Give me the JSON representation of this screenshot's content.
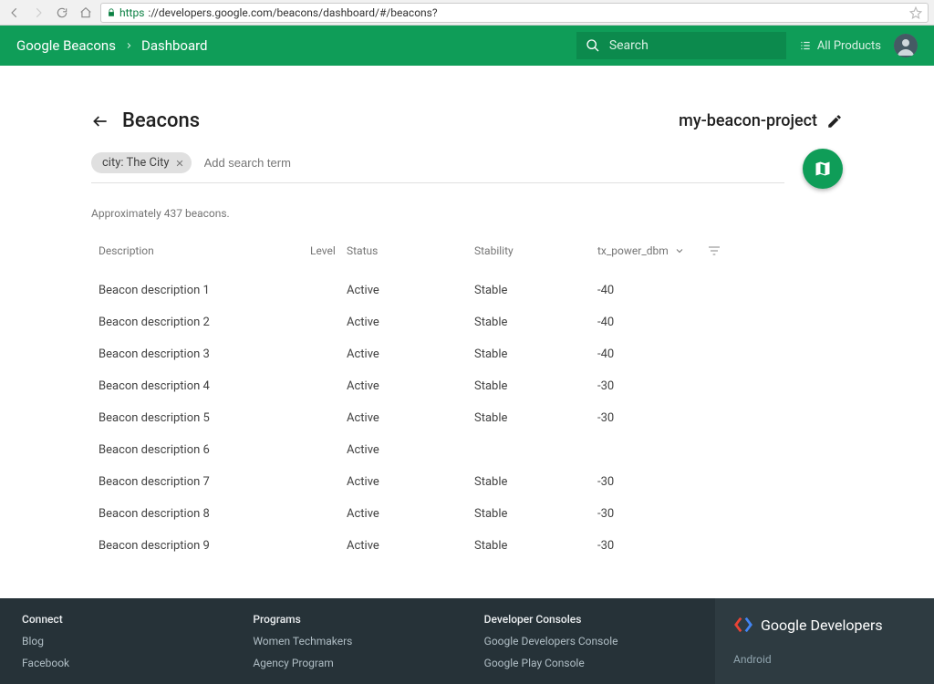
{
  "browser": {
    "url_prefix": "https",
    "url_rest": "://developers.google.com/beacons/dashboard/#/beacons?"
  },
  "header": {
    "app": "Google Beacons",
    "section": "Dashboard",
    "search_placeholder": "Search",
    "all_products": "All Products"
  },
  "page": {
    "back_title": "Beacons",
    "project": "my-beacon-project",
    "chip": "city: The City",
    "search_placeholder": "Add search term",
    "approx": "Approximately 437 beacons."
  },
  "columns": {
    "description": "Description",
    "level": "Level",
    "status": "Status",
    "stability": "Stability",
    "tx": "tx_power_dbm"
  },
  "rows": [
    {
      "description": "Beacon description 1",
      "level": "",
      "status": "Active",
      "stability": "Stable",
      "tx": "-40"
    },
    {
      "description": "Beacon description 2",
      "level": "",
      "status": "Active",
      "stability": "Stable",
      "tx": "-40"
    },
    {
      "description": "Beacon description 3",
      "level": "",
      "status": "Active",
      "stability": "Stable",
      "tx": "-40"
    },
    {
      "description": "Beacon description 4",
      "level": "",
      "status": "Active",
      "stability": "Stable",
      "tx": "-30"
    },
    {
      "description": "Beacon description 5",
      "level": "",
      "status": "Active",
      "stability": "Stable",
      "tx": "-30"
    },
    {
      "description": "Beacon description 6",
      "level": "",
      "status": "Active",
      "stability": "",
      "tx": ""
    },
    {
      "description": "Beacon description 7",
      "level": "",
      "status": "Active",
      "stability": "Stable",
      "tx": "-30"
    },
    {
      "description": "Beacon description 8",
      "level": "",
      "status": "Active",
      "stability": "Stable",
      "tx": "-30"
    },
    {
      "description": "Beacon description 9",
      "level": "",
      "status": "Active",
      "stability": "Stable",
      "tx": "-30"
    }
  ],
  "footer": {
    "col1": {
      "h": "Connect",
      "links": [
        "Blog",
        "Facebook"
      ]
    },
    "col2": {
      "h": "Programs",
      "links": [
        "Women Techmakers",
        "Agency Program"
      ]
    },
    "col3": {
      "h": "Developer Consoles",
      "links": [
        "Google Developers Console",
        "Google Play Console"
      ]
    },
    "brand": "Google Developers",
    "brand_sub": "Android"
  }
}
